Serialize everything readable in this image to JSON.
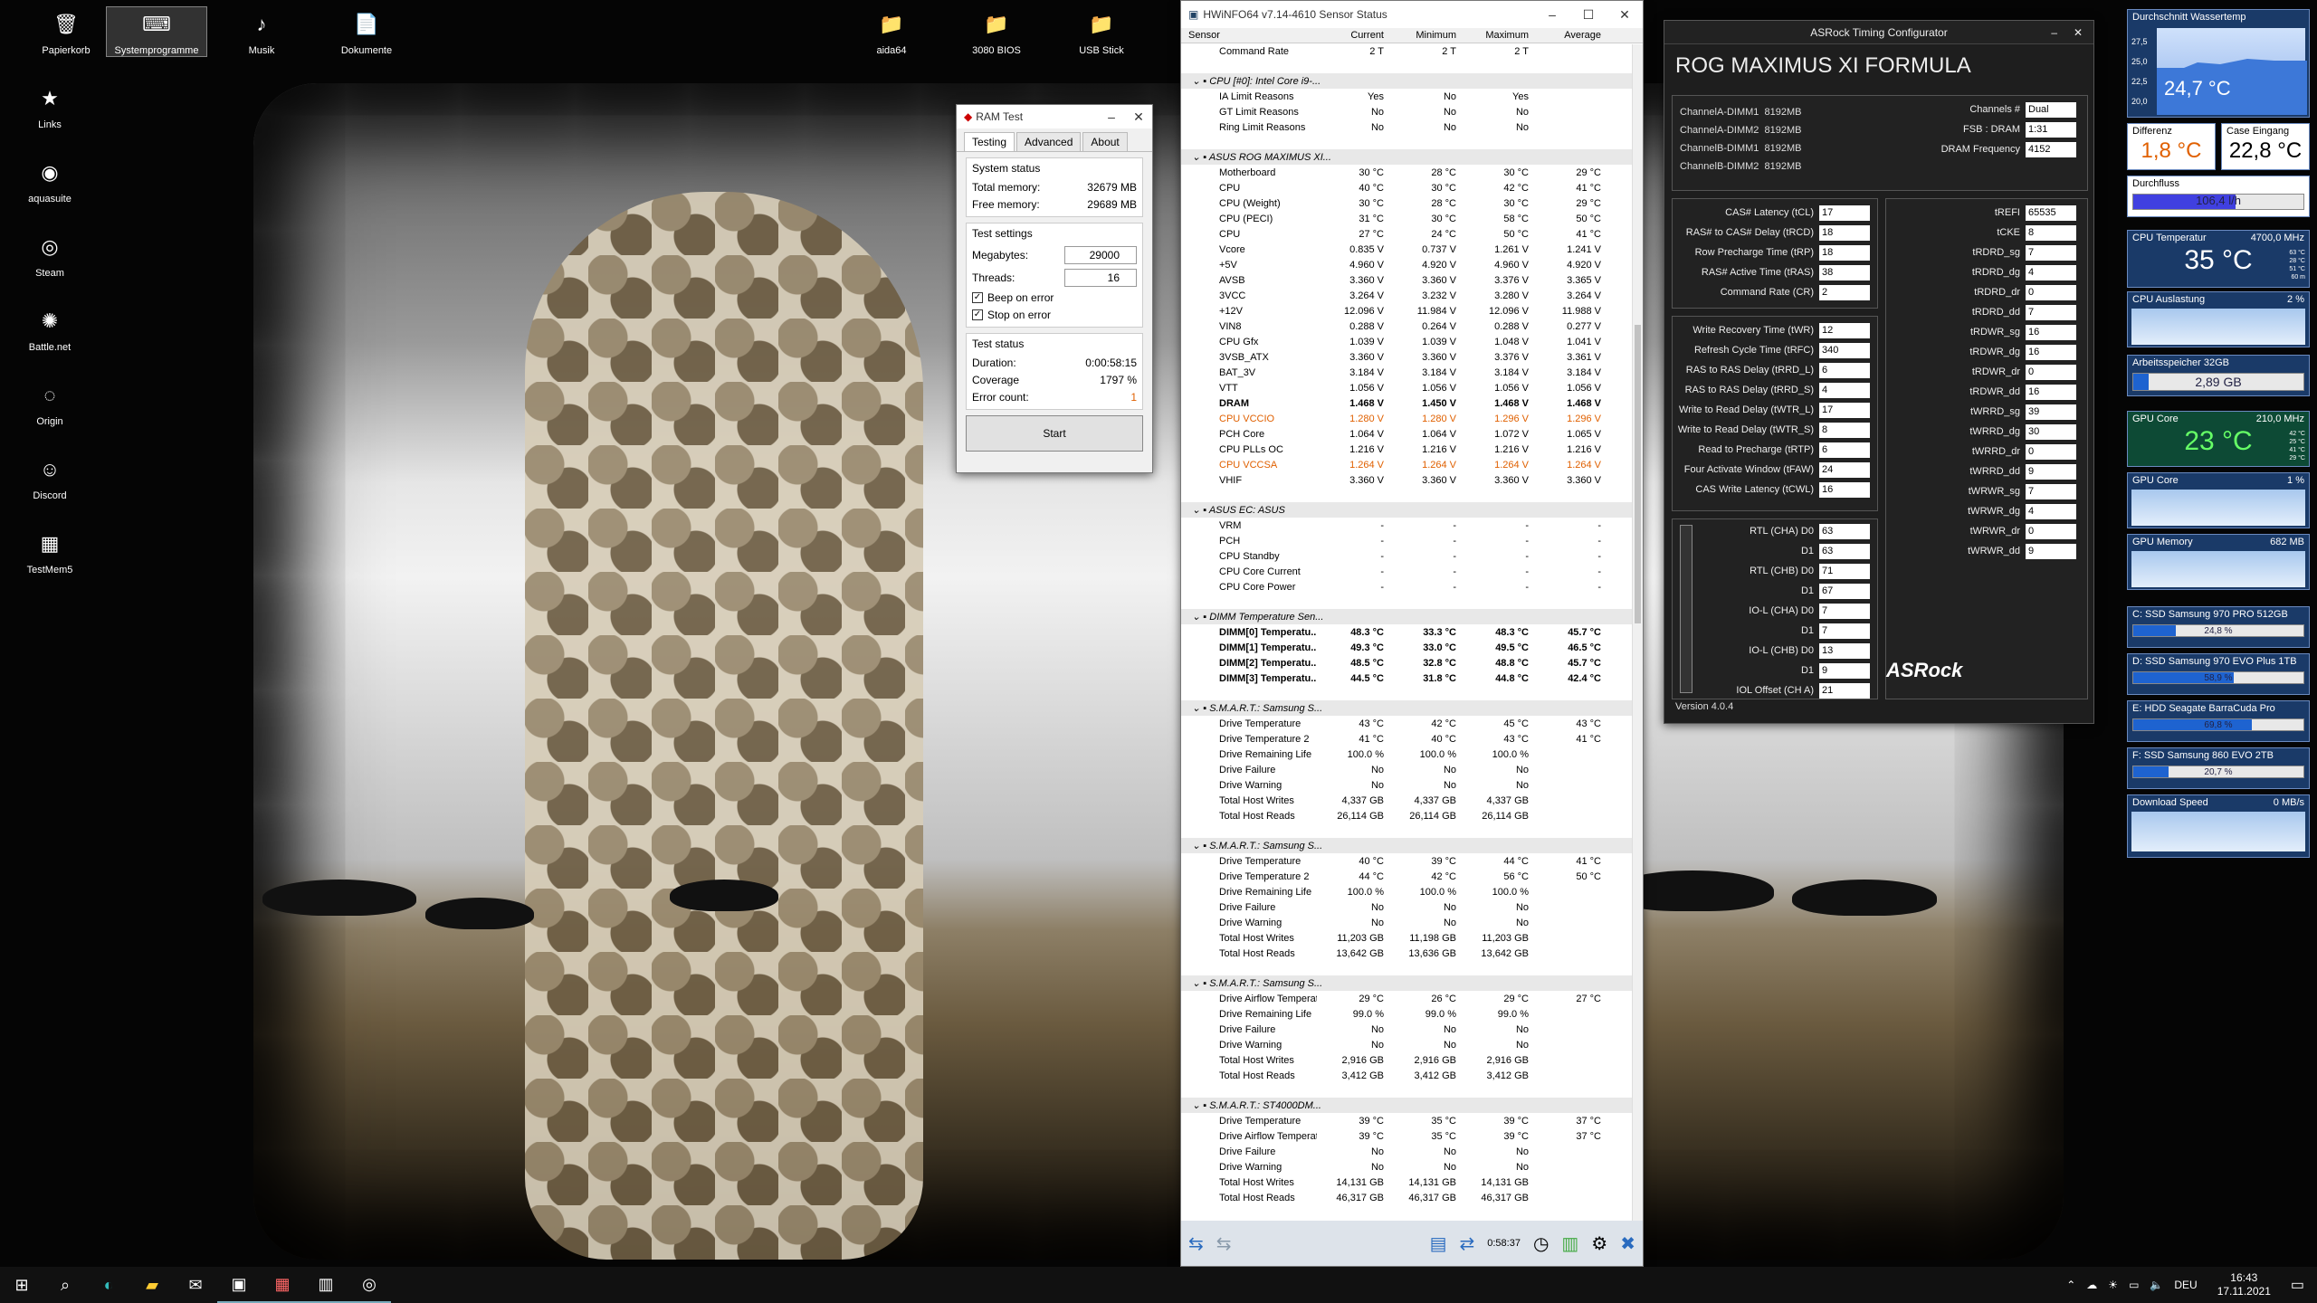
{
  "desktop": {
    "icons": [
      {
        "label": "Papierkorb",
        "glyph": "🗑",
        "x": 18,
        "y": 8
      },
      {
        "label": "Systemprogramme",
        "glyph": "⌨",
        "x": 118,
        "y": 8,
        "sel": true
      },
      {
        "label": "Musik",
        "glyph": "♪",
        "x": 234,
        "y": 8
      },
      {
        "label": "Dokumente",
        "glyph": "📄",
        "x": 350,
        "y": 8
      },
      {
        "label": "aida64",
        "glyph": "📁",
        "x": 930,
        "y": 8
      },
      {
        "label": "3080 BIOS",
        "glyph": "📁",
        "x": 1046,
        "y": 8
      },
      {
        "label": "USB Stick",
        "glyph": "📁",
        "x": 1162,
        "y": 8
      },
      {
        "label": "Links",
        "glyph": "★",
        "x": 0,
        "y": 90
      },
      {
        "label": "aquasuite",
        "glyph": "◉",
        "x": 0,
        "y": 172
      },
      {
        "label": "Steam",
        "glyph": "◎",
        "x": 0,
        "y": 254
      },
      {
        "label": "Battle.net",
        "glyph": "✺",
        "x": 0,
        "y": 336
      },
      {
        "label": "Origin",
        "glyph": "◌",
        "x": 0,
        "y": 418
      },
      {
        "label": "Discord",
        "glyph": "☺",
        "x": 0,
        "y": 500
      },
      {
        "label": "TestMem5",
        "glyph": "▦",
        "x": 0,
        "y": 582
      }
    ]
  },
  "ramtest": {
    "title": "RAM Test",
    "tabs": [
      "Testing",
      "Advanced",
      "About"
    ],
    "status_title": "System status",
    "total_label": "Total memory:",
    "total": "32679 MB",
    "free_label": "Free memory:",
    "free": "29689 MB",
    "settings_title": "Test settings",
    "mb_label": "Megabytes:",
    "mb": "29000",
    "th_label": "Threads:",
    "th": "16",
    "beep": "Beep on error",
    "stop": "Stop on error",
    "tstatus_title": "Test status",
    "dur_label": "Duration:",
    "dur": "0:00:58:15",
    "cov_label": "Coverage",
    "cov": "1797 %",
    "err_label": "Error count:",
    "err": "1",
    "start": "Start"
  },
  "hwinfo": {
    "title": "HWiNFO64 v7.14-4610 Sensor Status",
    "cols": [
      "Sensor",
      "Current",
      "Minimum",
      "Maximum",
      "Average"
    ],
    "rows": [
      [
        "Command Rate",
        "2 T",
        "2 T",
        "2 T",
        "",
        ""
      ],
      [
        "",
        "",
        "",
        "",
        "",
        "sp"
      ],
      [
        "CPU [#0]: Intel Core i9-...",
        "",
        "",
        "",
        "",
        "h"
      ],
      [
        "IA Limit Reasons",
        "Yes",
        "No",
        "Yes",
        "",
        ""
      ],
      [
        "GT Limit Reasons",
        "No",
        "No",
        "No",
        "",
        ""
      ],
      [
        "Ring Limit Reasons",
        "No",
        "No",
        "No",
        "",
        ""
      ],
      [
        "",
        "",
        "",
        "",
        "",
        "sp"
      ],
      [
        "ASUS ROG MAXIMUS XI...",
        "",
        "",
        "",
        "",
        "h"
      ],
      [
        "Motherboard",
        "30 °C",
        "28 °C",
        "30 °C",
        "29 °C",
        ""
      ],
      [
        "CPU",
        "40 °C",
        "30 °C",
        "42 °C",
        "41 °C",
        ""
      ],
      [
        "CPU (Weight)",
        "30 °C",
        "28 °C",
        "30 °C",
        "29 °C",
        ""
      ],
      [
        "CPU (PECI)",
        "31 °C",
        "30 °C",
        "58 °C",
        "50 °C",
        ""
      ],
      [
        "CPU",
        "27 °C",
        "24 °C",
        "50 °C",
        "41 °C",
        ""
      ],
      [
        "Vcore",
        "0.835 V",
        "0.737 V",
        "1.261 V",
        "1.241 V",
        ""
      ],
      [
        "+5V",
        "4.960 V",
        "4.920 V",
        "4.960 V",
        "4.920 V",
        ""
      ],
      [
        "AVSB",
        "3.360 V",
        "3.360 V",
        "3.376 V",
        "3.365 V",
        ""
      ],
      [
        "3VCC",
        "3.264 V",
        "3.232 V",
        "3.280 V",
        "3.264 V",
        ""
      ],
      [
        "+12V",
        "12.096 V",
        "11.984 V",
        "12.096 V",
        "11.988 V",
        ""
      ],
      [
        "VIN8",
        "0.288 V",
        "0.264 V",
        "0.288 V",
        "0.277 V",
        ""
      ],
      [
        "CPU Gfx",
        "1.039 V",
        "1.039 V",
        "1.048 V",
        "1.041 V",
        ""
      ],
      [
        "3VSB_ATX",
        "3.360 V",
        "3.360 V",
        "3.376 V",
        "3.361 V",
        ""
      ],
      [
        "BAT_3V",
        "3.184 V",
        "3.184 V",
        "3.184 V",
        "3.184 V",
        ""
      ],
      [
        "VTT",
        "1.056 V",
        "1.056 V",
        "1.056 V",
        "1.056 V",
        ""
      ],
      [
        "DRAM",
        "1.468 V",
        "1.450 V",
        "1.468 V",
        "1.468 V",
        "b"
      ],
      [
        "CPU VCCIO",
        "1.280 V",
        "1.280 V",
        "1.296 V",
        "1.296 V",
        "o"
      ],
      [
        "PCH Core",
        "1.064 V",
        "1.064 V",
        "1.072 V",
        "1.065 V",
        ""
      ],
      [
        "CPU PLLs OC",
        "1.216 V",
        "1.216 V",
        "1.216 V",
        "1.216 V",
        ""
      ],
      [
        "CPU VCCSA",
        "1.264 V",
        "1.264 V",
        "1.264 V",
        "1.264 V",
        "o"
      ],
      [
        "VHIF",
        "3.360 V",
        "3.360 V",
        "3.360 V",
        "3.360 V",
        ""
      ],
      [
        "",
        "",
        "",
        "",
        "",
        "sp"
      ],
      [
        "ASUS EC: ASUS",
        "",
        "",
        "",
        "",
        "h"
      ],
      [
        "VRM",
        "-",
        "-",
        "-",
        "-",
        ""
      ],
      [
        "PCH",
        "-",
        "-",
        "-",
        "-",
        ""
      ],
      [
        "CPU Standby",
        "-",
        "-",
        "-",
        "-",
        ""
      ],
      [
        "CPU Core Current",
        "-",
        "-",
        "-",
        "-",
        ""
      ],
      [
        "CPU Core Power",
        "-",
        "-",
        "-",
        "-",
        ""
      ],
      [
        "",
        "",
        "",
        "",
        "",
        "sp"
      ],
      [
        "DIMM Temperature Sen...",
        "",
        "",
        "",
        "",
        "h"
      ],
      [
        "DIMM[0] Temperatu...",
        "48.3 °C",
        "33.3 °C",
        "48.3 °C",
        "45.7 °C",
        "b"
      ],
      [
        "DIMM[1] Temperatu...",
        "49.3 °C",
        "33.0 °C",
        "49.5 °C",
        "46.5 °C",
        "b"
      ],
      [
        "DIMM[2] Temperatu...",
        "48.5 °C",
        "32.8 °C",
        "48.8 °C",
        "45.7 °C",
        "b"
      ],
      [
        "DIMM[3] Temperatu...",
        "44.5 °C",
        "31.8 °C",
        "44.8 °C",
        "42.4 °C",
        "b"
      ],
      [
        "",
        "",
        "",
        "",
        "",
        "sp"
      ],
      [
        "S.M.A.R.T.: Samsung S...",
        "",
        "",
        "",
        "",
        "h"
      ],
      [
        "Drive Temperature",
        "43 °C",
        "42 °C",
        "45 °C",
        "43 °C",
        ""
      ],
      [
        "Drive Temperature 2",
        "41 °C",
        "40 °C",
        "43 °C",
        "41 °C",
        ""
      ],
      [
        "Drive Remaining Life",
        "100.0 %",
        "100.0 %",
        "100.0 %",
        "",
        ""
      ],
      [
        "Drive Failure",
        "No",
        "No",
        "No",
        "",
        ""
      ],
      [
        "Drive Warning",
        "No",
        "No",
        "No",
        "",
        ""
      ],
      [
        "Total Host Writes",
        "4,337 GB",
        "4,337 GB",
        "4,337 GB",
        "",
        ""
      ],
      [
        "Total Host Reads",
        "26,114 GB",
        "26,114 GB",
        "26,114 GB",
        "",
        ""
      ],
      [
        "",
        "",
        "",
        "",
        "",
        "sp"
      ],
      [
        "S.M.A.R.T.: Samsung S...",
        "",
        "",
        "",
        "",
        "h"
      ],
      [
        "Drive Temperature",
        "40 °C",
        "39 °C",
        "44 °C",
        "41 °C",
        ""
      ],
      [
        "Drive Temperature 2",
        "44 °C",
        "42 °C",
        "56 °C",
        "50 °C",
        ""
      ],
      [
        "Drive Remaining Life",
        "100.0 %",
        "100.0 %",
        "100.0 %",
        "",
        ""
      ],
      [
        "Drive Failure",
        "No",
        "No",
        "No",
        "",
        ""
      ],
      [
        "Drive Warning",
        "No",
        "No",
        "No",
        "",
        ""
      ],
      [
        "Total Host Writes",
        "11,203 GB",
        "11,198 GB",
        "11,203 GB",
        "",
        ""
      ],
      [
        "Total Host Reads",
        "13,642 GB",
        "13,636 GB",
        "13,642 GB",
        "",
        ""
      ],
      [
        "",
        "",
        "",
        "",
        "",
        "sp"
      ],
      [
        "S.M.A.R.T.: Samsung S...",
        "",
        "",
        "",
        "",
        "h"
      ],
      [
        "Drive Airflow Temperature",
        "29 °C",
        "26 °C",
        "29 °C",
        "27 °C",
        ""
      ],
      [
        "Drive Remaining Life",
        "99.0 %",
        "99.0 %",
        "99.0 %",
        "",
        ""
      ],
      [
        "Drive Failure",
        "No",
        "No",
        "No",
        "",
        ""
      ],
      [
        "Drive Warning",
        "No",
        "No",
        "No",
        "",
        ""
      ],
      [
        "Total Host Writes",
        "2,916 GB",
        "2,916 GB",
        "2,916 GB",
        "",
        ""
      ],
      [
        "Total Host Reads",
        "3,412 GB",
        "3,412 GB",
        "3,412 GB",
        "",
        ""
      ],
      [
        "",
        "",
        "",
        "",
        "",
        "sp"
      ],
      [
        "S.M.A.R.T.: ST4000DM...",
        "",
        "",
        "",
        "",
        "h"
      ],
      [
        "Drive Temperature",
        "39 °C",
        "35 °C",
        "39 °C",
        "37 °C",
        ""
      ],
      [
        "Drive Airflow Temperature",
        "39 °C",
        "35 °C",
        "39 °C",
        "37 °C",
        ""
      ],
      [
        "Drive Failure",
        "No",
        "No",
        "No",
        "",
        ""
      ],
      [
        "Drive Warning",
        "No",
        "No",
        "No",
        "",
        ""
      ],
      [
        "Total Host Writes",
        "14,131 GB",
        "14,131 GB",
        "14,131 GB",
        "",
        ""
      ],
      [
        "Total Host Reads",
        "46,317 GB",
        "46,317 GB",
        "46,317 GB",
        "",
        ""
      ]
    ],
    "timer": "0:58:37"
  },
  "asrock": {
    "title": "ASRock Timing Configurator",
    "board": "ROG MAXIMUS XI FORMULA",
    "dimms": [
      [
        "ChannelA-DIMM1",
        "8192MB"
      ],
      [
        "ChannelA-DIMM2",
        "8192MB"
      ],
      [
        "ChannelB-DIMM1",
        "8192MB"
      ],
      [
        "ChannelB-DIMM2",
        "8192MB"
      ]
    ],
    "right_top": [
      [
        "Channels #",
        "Dual"
      ],
      [
        "FSB : DRAM",
        "1:31"
      ],
      [
        "DRAM Frequency",
        "4152"
      ]
    ],
    "primary": [
      [
        "CAS# Latency (tCL)",
        "17"
      ],
      [
        "RAS# to CAS# Delay (tRCD)",
        "18"
      ],
      [
        "Row Precharge Time (tRP)",
        "18"
      ],
      [
        "RAS# Active Time (tRAS)",
        "38"
      ],
      [
        "Command Rate (CR)",
        "2"
      ]
    ],
    "secondary": [
      [
        "Write Recovery Time (tWR)",
        "12"
      ],
      [
        "Refresh Cycle Time (tRFC)",
        "340"
      ],
      [
        "RAS to RAS Delay (tRRD_L)",
        "6"
      ],
      [
        "RAS to RAS Delay (tRRD_S)",
        "4"
      ],
      [
        "Write to Read Delay (tWTR_L)",
        "17"
      ],
      [
        "Write to Read Delay (tWTR_S)",
        "8"
      ],
      [
        "Read to Precharge (tRTP)",
        "6"
      ],
      [
        "Four Activate Window (tFAW)",
        "24"
      ],
      [
        "CAS Write Latency (tCWL)",
        "16"
      ]
    ],
    "rtl": [
      [
        "RTL (CHA) D0",
        "63"
      ],
      [
        "D1",
        "63"
      ],
      [
        "RTL (CHB) D0",
        "71"
      ],
      [
        "D1",
        "67"
      ],
      [
        "IO-L (CHA) D0",
        "7"
      ],
      [
        "D1",
        "7"
      ],
      [
        "IO-L (CHB) D0",
        "13"
      ],
      [
        "D1",
        "9"
      ],
      [
        "IOL Offset (CH A)",
        "21"
      ]
    ],
    "tertiary": [
      [
        "tREFI",
        "65535"
      ],
      [
        "tCKE",
        "8"
      ],
      [
        "tRDRD_sg",
        "7"
      ],
      [
        "tRDRD_dg",
        "4"
      ],
      [
        "tRDRD_dr",
        "0"
      ],
      [
        "tRDRD_dd",
        "7"
      ],
      [
        "tRDWR_sg",
        "16"
      ],
      [
        "tRDWR_dg",
        "16"
      ],
      [
        "tRDWR_dr",
        "0"
      ],
      [
        "tRDWR_dd",
        "16"
      ],
      [
        "tWRRD_sg",
        "39"
      ],
      [
        "tWRRD_dg",
        "30"
      ],
      [
        "tWRRD_dr",
        "0"
      ],
      [
        "tWRRD_dd",
        "9"
      ],
      [
        "tWRWR_sg",
        "7"
      ],
      [
        "tWRWR_dg",
        "4"
      ],
      [
        "tWRWR_dr",
        "0"
      ],
      [
        "tWRWR_dd",
        "9"
      ]
    ],
    "logo": "ASRock",
    "version": "Version 4.0.4"
  },
  "gadgets": {
    "wasser_label": "Durchschnitt Wassertemp",
    "wasser": "24,7 °C",
    "y_ticks": [
      "27,5",
      "25,0",
      "22,5",
      "20,0"
    ],
    "diff_label": "Differenz",
    "diff": "1,8 °C",
    "case_label": "Case Eingang",
    "case": "22,8 °C",
    "flow_label": "Durchfluss",
    "flow": "106,4 l/h",
    "flow_pct": 60,
    "cpu_temp_label": "CPU Temperatur",
    "cpu_mhz": "4700,0 MHz",
    "cpu_temp": "35 °C",
    "cpu_small": [
      "63 °C",
      "28 °C",
      "51 °C",
      "60 m"
    ],
    "cpu_load_label": "CPU Auslastung",
    "cpu_load": "2 %",
    "ram_label": "Arbeitsspeicher 32GB",
    "ram": "2,89 GB",
    "ram_pct": 9,
    "gpu_label": "GPU Core",
    "gpu_mhz": "210,0 MHz",
    "gpu_temp": "23 °C",
    "gpu_small": [
      "42 °C",
      "25 °C",
      "41 °C",
      "29 °C"
    ],
    "gpu_load_label": "GPU Core",
    "gpu_load": "1 %",
    "gpu_mem_label": "GPU Memory",
    "gpu_mem": "682 MB",
    "drives": [
      [
        "C: SSD Samsung 970 PRO 512GB",
        "24,8 %",
        24.8
      ],
      [
        "D: SSD Samsung 970 EVO Plus 1TB",
        "58,9 %",
        58.9
      ],
      [
        "E: HDD Seagate BarraCuda Pro",
        "69,8 %",
        69.8
      ],
      [
        "F: SSD Samsung 860 EVO 2TB",
        "20,7 %",
        20.7
      ]
    ],
    "dl_label": "Download Speed",
    "dl": "0 MB/s"
  },
  "taskbar": {
    "lang": "DEU",
    "time": "16:43",
    "date": "17.11.2021"
  }
}
